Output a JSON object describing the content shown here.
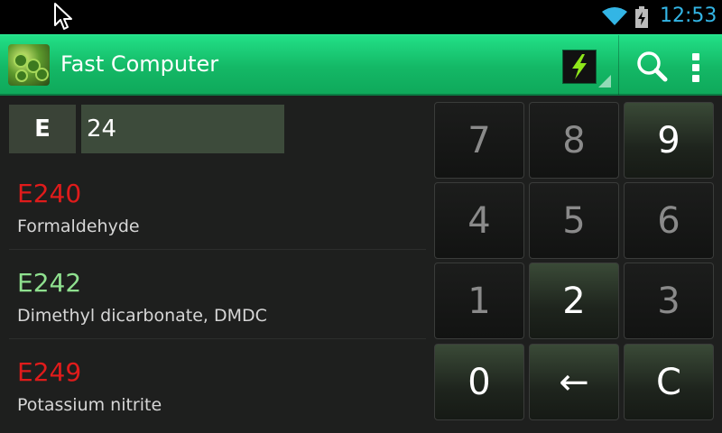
{
  "status_bar": {
    "time": "12:53",
    "accent_color": "#33b5e5",
    "icons": [
      "mouse-cursor-icon",
      "wifi-icon",
      "battery-charging-icon"
    ]
  },
  "action_bar": {
    "title": "Fast Computer",
    "background_color": "#14b866",
    "icons": [
      "app-peas-icon",
      "lightning-bolt-icon",
      "search-icon",
      "overflow-menu-icon"
    ]
  },
  "input": {
    "prefix": "E",
    "value": "24"
  },
  "results": [
    {
      "code": "E240",
      "name": "Formaldehyde",
      "color": "#e01b1b"
    },
    {
      "code": "E242",
      "name": "Dimethyl dicarbonate, DMDC",
      "color": "#8fe08f"
    },
    {
      "code": "E249",
      "name": "Potassium nitrite",
      "color": "#e01b1b"
    }
  ],
  "keypad": {
    "keys": [
      {
        "label": "7",
        "active": false
      },
      {
        "label": "8",
        "active": false
      },
      {
        "label": "9",
        "active": true
      },
      {
        "label": "4",
        "active": false
      },
      {
        "label": "5",
        "active": false
      },
      {
        "label": "6",
        "active": false
      },
      {
        "label": "1",
        "active": false
      },
      {
        "label": "2",
        "active": true
      },
      {
        "label": "3",
        "active": false
      },
      {
        "label": "0",
        "active": true
      },
      {
        "label": "←",
        "active": true
      },
      {
        "label": "C",
        "active": true
      }
    ]
  }
}
